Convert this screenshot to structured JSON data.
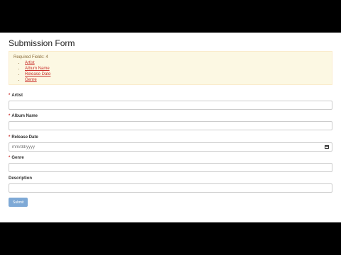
{
  "form": {
    "title": "Submission Form",
    "required_summary": "Required Fields: 4",
    "required_links": [
      "Artist",
      "Album Name",
      "Release Date",
      "Genre"
    ],
    "fields": [
      {
        "label": "Artist",
        "required": "*",
        "value": ""
      },
      {
        "label": "Album Name",
        "required": "*",
        "value": ""
      },
      {
        "label": "Release Date",
        "required": "*",
        "placeholder": "mm/dd/yyyy"
      },
      {
        "label": "Genre",
        "required": "*",
        "value": ""
      },
      {
        "label": "Description",
        "value": ""
      }
    ],
    "submit_label": "Submit"
  },
  "colors": {
    "alert_bg": "#fcf8e3",
    "link_red": "#c9302c",
    "submit_bg": "#7ea9d6"
  }
}
